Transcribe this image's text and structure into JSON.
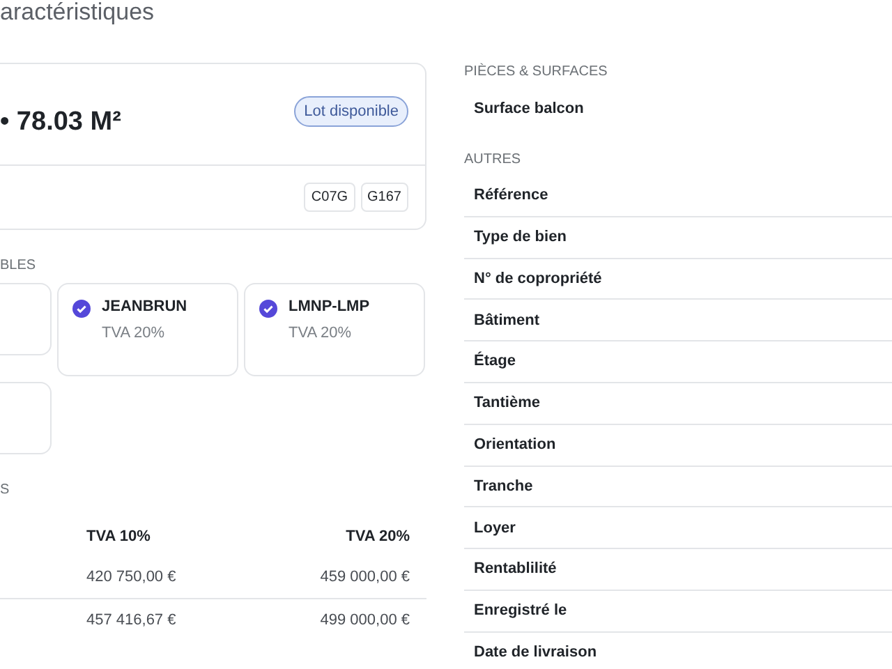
{
  "page_title": "aractéristiques",
  "summary_card": {
    "surface": "• 78.03 M²",
    "status_badge": "Lot disponible",
    "tags": [
      "C07G",
      "G167"
    ]
  },
  "regimes": {
    "heading": "BLES",
    "items": [
      {
        "kind": "clipped"
      },
      {
        "kind": "regime",
        "name": "JEANBRUN",
        "tva": "TVA 20%",
        "checked": true
      },
      {
        "kind": "regime",
        "name": "LMNP-LMP",
        "tva": "TVA 20%",
        "checked": true
      },
      {
        "kind": "clipped"
      }
    ]
  },
  "prices": {
    "heading": "S",
    "columns": [
      "TVA 10%",
      "TVA 20%"
    ],
    "rows": [
      [
        "420 750,00 €",
        "459 000,00 €"
      ],
      [
        "457 416,67 €",
        "499 000,00 €"
      ]
    ]
  },
  "rooms": {
    "heading": "PIÈCES & SURFACES",
    "items": [
      "Surface balcon"
    ]
  },
  "others": {
    "heading": "AUTRES",
    "items": [
      "Référence",
      "Type de bien",
      "N° de copropriété",
      "Bâtiment",
      "Étage",
      "Tantième",
      "Orientation",
      "Tranche",
      "Loyer",
      "Rentablilité",
      "Enregistré le",
      "Date de livraison"
    ]
  }
}
